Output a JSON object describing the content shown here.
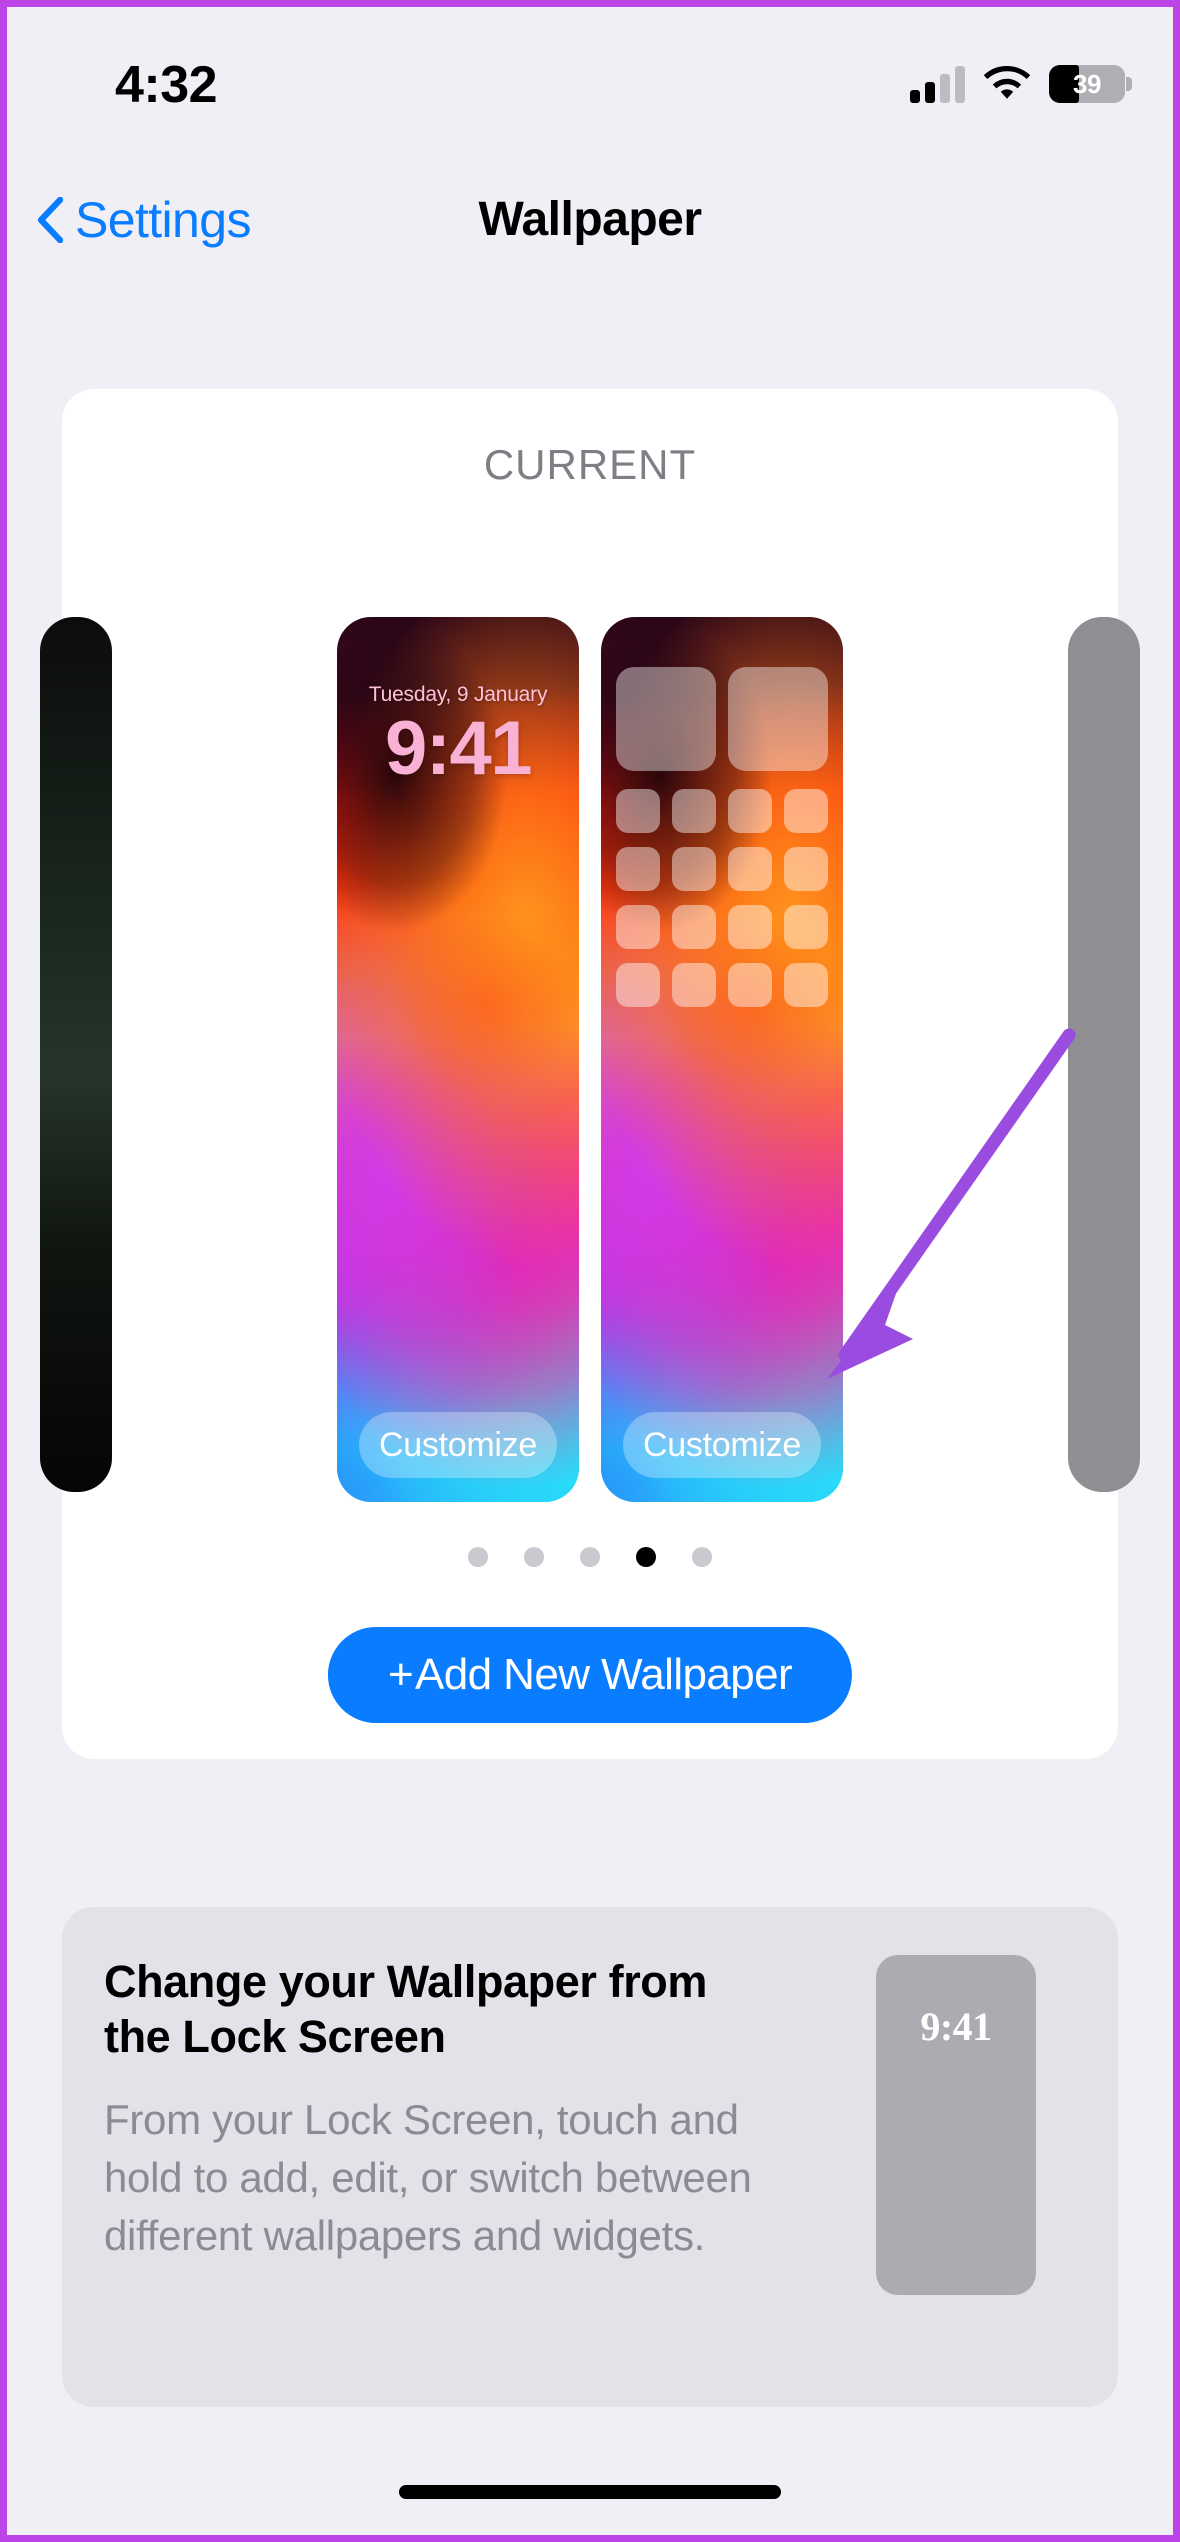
{
  "status_bar": {
    "time": "4:32",
    "signal_icon": "cellular-signal-icon",
    "signal_bars_filled": 2,
    "signal_bars_total": 4,
    "wifi_icon": "wifi-icon",
    "battery_icon": "battery-icon",
    "battery_percent": "39"
  },
  "nav": {
    "back_icon": "chevron-left-icon",
    "back_label": "Settings",
    "title": "Wallpaper"
  },
  "current_section": {
    "label": "CURRENT",
    "previews": [
      {
        "kind": "lock-screen",
        "date": "Tuesday, 9 January",
        "time": "9:41",
        "customize_label": "Customize"
      },
      {
        "kind": "home-screen",
        "customize_label": "Customize",
        "widget_count": 2,
        "icon_rows": 4,
        "icons_per_row": 4
      }
    ],
    "peek_left_color": "#151a15",
    "peek_right_color": "#8e8e93",
    "page_dots": {
      "count": 5,
      "active_index": 3
    },
    "add_button": {
      "plus_icon": "plus-icon",
      "label": "Add New Wallpaper",
      "color": "#0a7cff"
    }
  },
  "annotation": {
    "arrow_icon": "arrow-down-left-icon",
    "color": "#9a4be0"
  },
  "info_card": {
    "title": "Change your Wallpaper from the Lock Screen",
    "body": "From your Lock Screen, touch and hold to add, edit, or switch between different wallpapers and widgets.",
    "thumbnail_time": "9:41"
  },
  "home_indicator": {
    "name": "home-indicator"
  },
  "colors": {
    "page_background": "#f0eff5",
    "card_background": "#ffffff",
    "info_card_background": "#e3e2e9",
    "accent_blue": "#0a7cff",
    "secondary_text": "#8b8b93",
    "border_highlight": "#bd45e8"
  }
}
